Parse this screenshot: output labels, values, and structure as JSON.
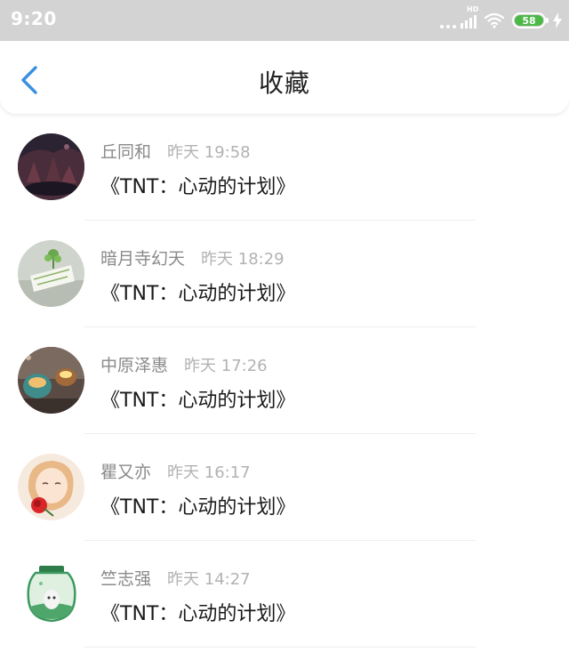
{
  "status_bar": {
    "time": "9:20",
    "network": "HD",
    "battery": "58"
  },
  "header": {
    "title": "收藏",
    "back_icon": "chevron-left-icon"
  },
  "items": [
    {
      "user": "丘同和",
      "time": "昨天 19:58",
      "title": "《TNT：心动的计划》"
    },
    {
      "user": "暗月寺幻天",
      "time": "昨天 18:29",
      "title": "《TNT：心动的计划》"
    },
    {
      "user": "中原泽惠",
      "time": "昨天 17:26",
      "title": "《TNT：心动的计划》"
    },
    {
      "user": "瞿又亦",
      "time": "昨天 16:17",
      "title": "《TNT：心动的计划》"
    },
    {
      "user": "竺志强",
      "time": "昨天 14:27",
      "title": "《TNT：心动的计划》"
    }
  ],
  "colors": {
    "status_bar": "#d3d3d3",
    "accent": "#3b8fe0",
    "battery": "#4cb847"
  }
}
